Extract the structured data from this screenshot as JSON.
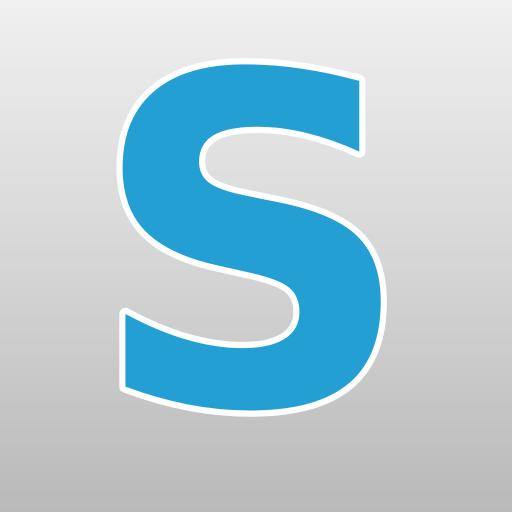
{
  "app_icon": {
    "letter": "S",
    "colors": {
      "letter_fill": "#239fd4",
      "letter_outline": "#ffffff",
      "background_top": "#f0f0f0",
      "background_bottom": "#b9b9b9"
    }
  }
}
